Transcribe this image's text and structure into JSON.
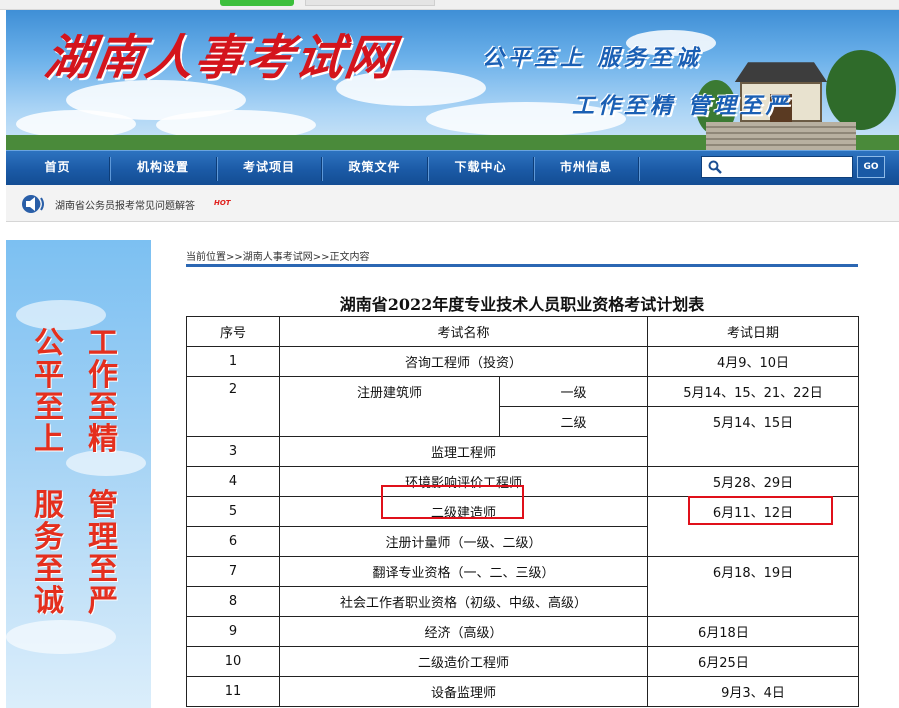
{
  "site": {
    "logo_text": "湖南人事考试网",
    "slogan_line1": "公平至上  服务至诚",
    "slogan_line2": "工作至精  管理至严"
  },
  "nav": {
    "items": [
      "首页",
      "机构设置",
      "考试项目",
      "政策文件",
      "下载中心",
      "市州信息"
    ],
    "search_placeholder": "",
    "go_label": "GO"
  },
  "notice": {
    "text": "湖南省公务员报考常见问题解答",
    "badge": "HOT"
  },
  "sidebar": {
    "col_left_top": [
      "公",
      "平",
      "至",
      "上"
    ],
    "col_left_bottom": [
      "服",
      "务",
      "至",
      "诚"
    ],
    "col_right_top": [
      "工",
      "作",
      "至",
      "精"
    ],
    "col_right_bottom": [
      "管",
      "理",
      "至",
      "严"
    ]
  },
  "breadcrumb": "当前位置>>湖南人事考试网>>正文内容",
  "document": {
    "title": "湖南省2022年度专业技术人员职业资格考试计划表",
    "headers": [
      "序号",
      "考试名称",
      "考试日期"
    ],
    "rows": [
      {
        "no": "1",
        "name": "咨询工程师（投资）",
        "date": "4月9、10日"
      },
      {
        "no": "2",
        "name": "注册建筑师",
        "sub1": "一级",
        "date1": "5月14、15、21、22日",
        "sub2": "二级",
        "date2": "5月14、15日"
      },
      {
        "no": "3",
        "name": "监理工程师"
      },
      {
        "no": "4",
        "name": "环境影响评价工程师",
        "date": "5月28、29日"
      },
      {
        "no": "5",
        "name": "二级建造师",
        "date": "6月11、12日"
      },
      {
        "no": "6",
        "name": "注册计量师（一级、二级）"
      },
      {
        "no": "7",
        "name": "翻译专业资格（一、二、三级）",
        "date": "6月18、19日"
      },
      {
        "no": "8",
        "name": "社会工作者职业资格（初级、中级、高级）"
      },
      {
        "no": "9",
        "name": "经济（高级）",
        "date": "6月18日"
      },
      {
        "no": "10",
        "name": "二级造价工程师",
        "date": "6月25日"
      },
      {
        "no": "11",
        "name": "设备监理师",
        "date": "9月3、4日"
      }
    ]
  },
  "colors": {
    "nav_blue": "#1b5aa6",
    "highlight_red": "#e0101a",
    "logo_red": "#d4141c"
  }
}
